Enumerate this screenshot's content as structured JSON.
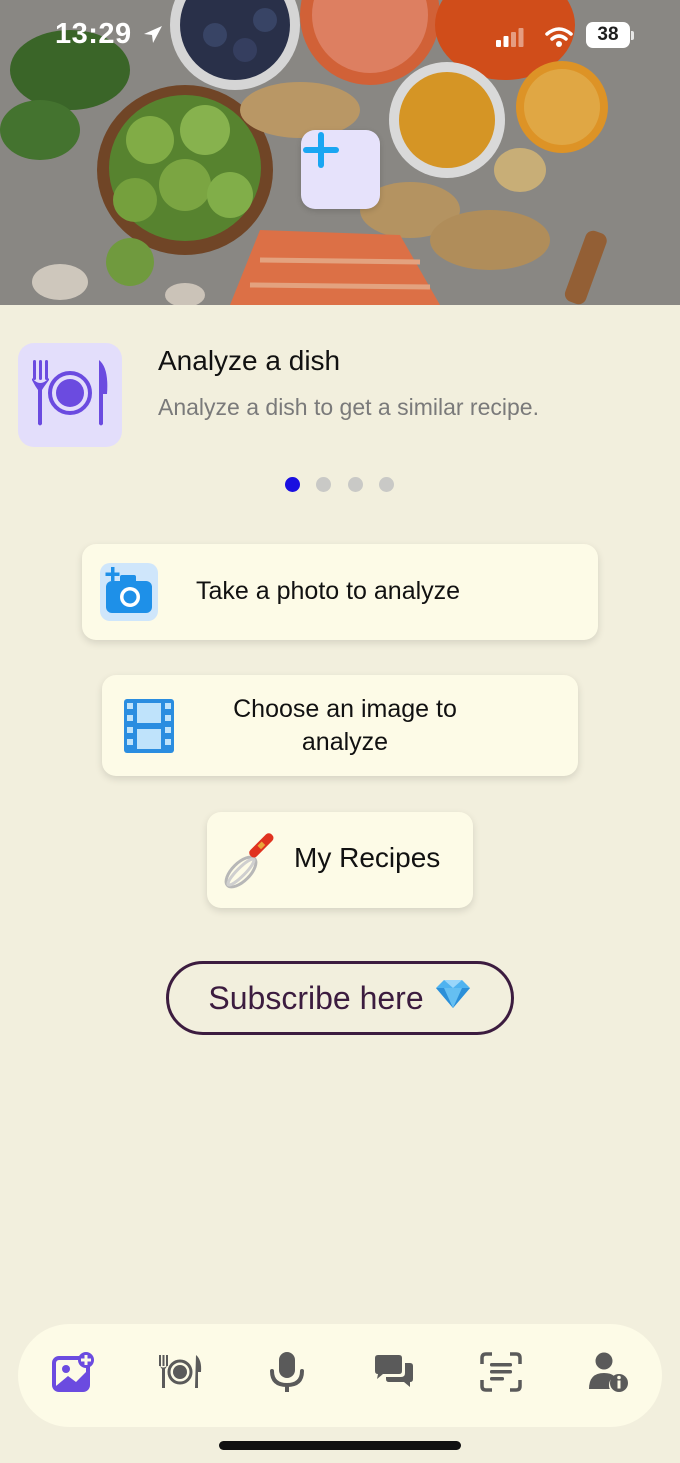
{
  "status_bar": {
    "time": "13:29",
    "battery": "38",
    "icons": [
      "location-arrow-icon",
      "signal-icon",
      "wifi-icon",
      "battery-icon"
    ]
  },
  "hero": {
    "image": "food-ingredients-photo",
    "add_icon": "plus-icon"
  },
  "feature": {
    "icon": "plate-fork-knife-icon",
    "title": "Analyze a dish",
    "description": "Analyze a dish to get a similar recipe.",
    "page_count": 4,
    "active_page": 1
  },
  "actions": {
    "take_photo": {
      "label": "Take a photo to analyze",
      "icon": "camera-plus-icon"
    },
    "choose_image": {
      "label": "Choose an image to analyze",
      "icon": "film-strip-icon"
    },
    "my_recipes": {
      "label": "My Recipes",
      "icon": "whisk-icon"
    }
  },
  "subscribe": {
    "label": "Subscribe here",
    "icon": "gem-icon"
  },
  "tab_bar": {
    "tabs": [
      {
        "name": "image-add-icon",
        "active": true
      },
      {
        "name": "plate-fork-knife-icon",
        "active": false
      },
      {
        "name": "microphone-icon",
        "active": false
      },
      {
        "name": "chat-bubbles-icon",
        "active": false
      },
      {
        "name": "text-scan-icon",
        "active": false
      },
      {
        "name": "user-info-icon",
        "active": false
      }
    ]
  },
  "colors": {
    "background": "#f2efdd",
    "card": "#fdfbe7",
    "accent_purple": "#6b4be0",
    "plus_blue": "#1aa6f2",
    "active_dot": "#1a0fe0",
    "subscribe_text": "#3c1c3f",
    "tab_icon": "#5a5a5a"
  }
}
